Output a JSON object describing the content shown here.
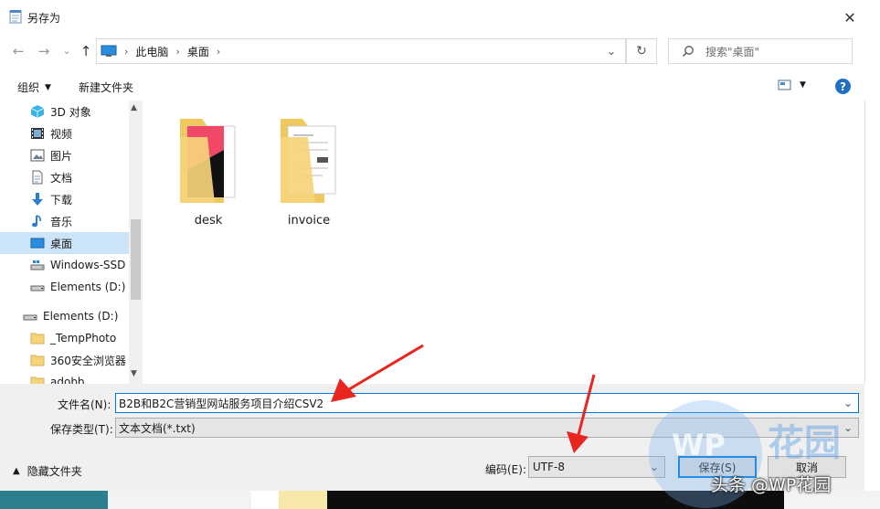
{
  "window": {
    "title": "另存为",
    "close_glyph": "✕"
  },
  "nav": {
    "back_glyph": "←",
    "forward_glyph": "→",
    "recent_glyph": "⌄",
    "up_glyph": "↑",
    "breadcrumb": [
      "此电脑",
      "桌面"
    ],
    "dropdown_glyph": "⌄",
    "refresh_glyph": "↻",
    "search_placeholder": "搜索\"桌面\""
  },
  "toolbar": {
    "organize": "组织",
    "new_folder": "新建文件夹",
    "help": "?"
  },
  "sidebar": {
    "items": [
      {
        "label": "3D 对象",
        "icon": "cube-3d-icon"
      },
      {
        "label": "视频",
        "icon": "video-icon"
      },
      {
        "label": "图片",
        "icon": "picture-icon"
      },
      {
        "label": "文档",
        "icon": "document-icon"
      },
      {
        "label": "下载",
        "icon": "download-icon"
      },
      {
        "label": "音乐",
        "icon": "music-icon"
      },
      {
        "label": "桌面",
        "icon": "desktop-icon",
        "selected": true
      },
      {
        "label": "Windows-SSD",
        "icon": "drive-icon"
      },
      {
        "label": "Elements (D:)",
        "icon": "drive-icon"
      },
      {
        "label": "Elements (D:)",
        "icon": "drive-icon"
      },
      {
        "label": "_TempPhoto",
        "icon": "folder-icon"
      },
      {
        "label": "360安全浏览器",
        "icon": "folder-icon"
      },
      {
        "label": "adobb",
        "icon": "folder-icon"
      }
    ]
  },
  "files": [
    {
      "name": "desk"
    },
    {
      "name": "invoice"
    }
  ],
  "form": {
    "filename_label": "文件名(N):",
    "filename_value": "B2B和B2C营销型网站服务项目介绍CSV2",
    "filetype_label": "保存类型(T):",
    "filetype_value": "文本文档(*.txt)",
    "encoding_label": "编码(E):",
    "encoding_value": "UTF-8",
    "hide_folders": "隐藏文件夹",
    "save": "保存(S)",
    "cancel": "取消"
  },
  "watermark": {
    "logo": "花园",
    "caption": "头条 @WP花园"
  },
  "colors": {
    "accent": "#0078d7",
    "selection": "#cce4f7",
    "arrow": "#e8251f"
  }
}
